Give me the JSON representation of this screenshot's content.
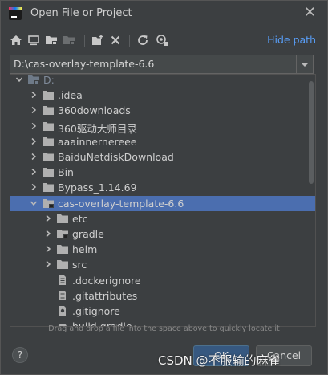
{
  "window": {
    "title": "Open File or Project",
    "close_symbol": "✕"
  },
  "toolbar": {
    "icons": [
      "home-icon",
      "desktop-icon",
      "project-folder-icon",
      "module-folder-icon",
      "new-folder-icon",
      "delete-icon",
      "refresh-icon",
      "show-hidden-icon"
    ],
    "hide_path_label": "Hide path"
  },
  "path_field": {
    "value": "D:\\cas-overlay-template-6.6"
  },
  "tree": {
    "rows": [
      {
        "label": "D:",
        "kind": "drive",
        "expanded": true,
        "depth": 0
      },
      {
        "label": ".idea",
        "kind": "folder",
        "expanded": false,
        "depth": 1
      },
      {
        "label": "360downloads",
        "kind": "folder",
        "expanded": false,
        "depth": 1
      },
      {
        "label": "360驱动大师目录",
        "kind": "folder",
        "expanded": false,
        "depth": 1
      },
      {
        "label": "aaainnernereee",
        "kind": "folder",
        "expanded": false,
        "depth": 1
      },
      {
        "label": "BaiduNetdiskDownload",
        "kind": "folder",
        "expanded": false,
        "depth": 1
      },
      {
        "label": "Bin",
        "kind": "folder",
        "expanded": false,
        "depth": 1
      },
      {
        "label": "Bypass_1.14.69",
        "kind": "folder",
        "expanded": false,
        "depth": 1
      },
      {
        "label": "cas-overlay-template-6.6",
        "kind": "project-folder",
        "expanded": true,
        "depth": 1,
        "selected": true
      },
      {
        "label": "etc",
        "kind": "folder",
        "expanded": false,
        "depth": 2
      },
      {
        "label": "gradle",
        "kind": "project-folder",
        "expanded": false,
        "depth": 2
      },
      {
        "label": "helm",
        "kind": "folder",
        "expanded": false,
        "depth": 2
      },
      {
        "label": "src",
        "kind": "folder",
        "expanded": false,
        "depth": 2
      },
      {
        "label": ".dockerignore",
        "kind": "file",
        "depth": 2
      },
      {
        "label": ".gitattributes",
        "kind": "file",
        "depth": 2
      },
      {
        "label": ".gitignore",
        "kind": "gitignore-file",
        "depth": 2
      },
      {
        "label": "build.gradle",
        "kind": "gradle-file",
        "depth": 2
      }
    ]
  },
  "drop_hint": "Drag and drop a file into the space above to quickly locate it",
  "buttons": {
    "help": "?",
    "ok": "OK",
    "cancel": "Cancel"
  },
  "watermark": "CSDN @不服输的麻雀",
  "colors": {
    "background": "#3c3f41",
    "selection": "#4b6eaf",
    "link": "#589df6",
    "ok_button": "#365880"
  }
}
